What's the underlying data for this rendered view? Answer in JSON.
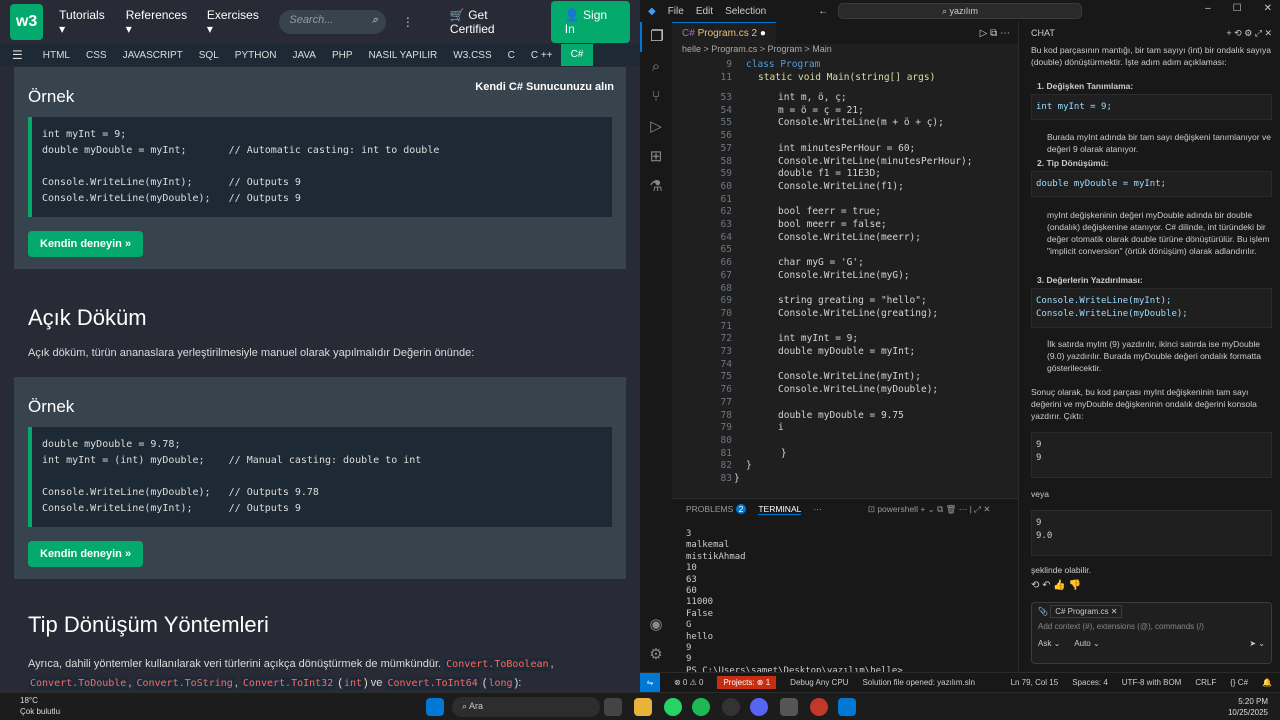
{
  "w3": {
    "logo": "w3 schools",
    "nav": [
      "Tutorials",
      "References",
      "Exercises"
    ],
    "search_placeholder": "Search...",
    "get_certified": "Get Certified",
    "sign_in": "Sign In",
    "topics": [
      "HTML",
      "CSS",
      "JAVASCRIPT",
      "SQL",
      "PYTHON",
      "JAVA",
      "PHP",
      "NASIL YAPILIR",
      "W3.CSS",
      "C",
      "C ++",
      "C#"
    ],
    "active_topic": "C#"
  },
  "page": {
    "example1_heading": "Örnek",
    "kendi_server": "Kendi C# Sunucunuzu alın",
    "try_button": "Kendin deneyin »",
    "explicit_heading": "Açık Döküm",
    "explicit_text": "Açık döküm, türün ananaslara yerleştirilmesiyle manuel olarak yapılmalıdır Değerin önünde:",
    "example2_heading": "Örnek",
    "methods_heading": "Tip Dönüşüm Yöntemleri",
    "methods_text": "Ayrıca, dahili yöntemler kullanılarak veri türlerini açıkça dönüştürmek de mümkündür.",
    "methods_chips": [
      "Convert.ToBoolean",
      "Convert.ToDouble",
      "Convert.ToString",
      "Convert.ToInt32",
      "int",
      "ve",
      "Convert.ToInt64",
      "long"
    ]
  },
  "code1": [
    "int myInt = 9;",
    "double myDouble = myInt;       // Automatic casting: int to double",
    "",
    "Console.WriteLine(myInt);      // Outputs 9",
    "Console.WriteLine(myDouble);   // Outputs 9"
  ],
  "code2": [
    "double myDouble = 9.78;",
    "int myInt = (int) myDouble;    // Manual casting: double to int",
    "",
    "Console.WriteLine(myDouble);   // Outputs 9.78",
    "Console.WriteLine(myInt);      // Outputs 9"
  ],
  "vscode": {
    "menu": [
      "File",
      "Edit",
      "Selection"
    ],
    "command_search": "yazılım",
    "tab": "Program.cs 2",
    "breadcrumb": "helle > Program.cs > Program > Main",
    "sticky": [
      {
        "num": "9",
        "text": "class Program"
      },
      {
        "num": "11",
        "text": "static void Main(string[] args)"
      }
    ],
    "lines": [
      {
        "num": "53",
        "text": "int m, ö, ç;"
      },
      {
        "num": "54",
        "text": "m = ö = ç = 21;"
      },
      {
        "num": "55",
        "text": "Console.WriteLine(m + ö + ç);"
      },
      {
        "num": "56",
        "text": ""
      },
      {
        "num": "57",
        "text": "int minutesPerHour = 60;"
      },
      {
        "num": "58",
        "text": "Console.WriteLine(minutesPerHour);"
      },
      {
        "num": "59",
        "text": "double f1 = 11E3D;"
      },
      {
        "num": "60",
        "text": "Console.WriteLine(f1);"
      },
      {
        "num": "61",
        "text": ""
      },
      {
        "num": "62",
        "text": "bool feerr = true;"
      },
      {
        "num": "63",
        "text": "bool meerr = false;"
      },
      {
        "num": "64",
        "text": "Console.WriteLine(meerr);"
      },
      {
        "num": "65",
        "text": ""
      },
      {
        "num": "66",
        "text": "char myG = 'G';"
      },
      {
        "num": "67",
        "text": "Console.WriteLine(myG);"
      },
      {
        "num": "68",
        "text": ""
      },
      {
        "num": "69",
        "text": "string greating = \"hello\";"
      },
      {
        "num": "70",
        "text": "Console.WriteLine(greating);"
      },
      {
        "num": "71",
        "text": ""
      },
      {
        "num": "72",
        "text": "int myInt = 9;"
      },
      {
        "num": "73",
        "text": "double myDouble = myInt;"
      },
      {
        "num": "74",
        "text": ""
      },
      {
        "num": "75",
        "text": "Console.WriteLine(myInt);"
      },
      {
        "num": "76",
        "text": "Console.WriteLine(myDouble);"
      },
      {
        "num": "77",
        "text": ""
      },
      {
        "num": "78",
        "text": "double myDouble = 9.75"
      },
      {
        "num": "79",
        "text": "i"
      },
      {
        "num": "80",
        "text": ""
      },
      {
        "num": "81",
        "text": "    }"
      },
      {
        "num": "82",
        "text": "}"
      },
      {
        "num": "83",
        "text": "}"
      }
    ],
    "panel_tabs": [
      "PROBLEMS",
      "TERMINAL"
    ],
    "problems_count": "2",
    "shell": "powershell",
    "terminal": [
      "3",
      "malkemal",
      "mistikAhmad",
      "10",
      "63",
      "60",
      "11000",
      "False",
      "G",
      "hello",
      "9",
      "9",
      "PS C:\\Users\\samet\\Desktop\\yazılım\\helle> "
    ],
    "status": [
      "Projects: ⊗ 1",
      "Debug Any CPU",
      "Solution file opened: yazılım.sln",
      "Ln 79, Col 15",
      "Spaces: 4",
      "UTF-8 with BOM",
      "CRLF",
      "{} C#"
    ]
  },
  "chat": {
    "title": "CHAT",
    "intro": "Bu kod parçasının mantığı, bir tam sayıyı (int) bir ondalık sayıya (double) dönüştürmektir. İşte adım adım açıklaması:",
    "step1": "1. Değişken Tanımlama:",
    "code_a": "int myInt = 9;",
    "text_a": "Burada myInt adında bir tam sayı değişkeni tanımlanıyor ve değeri 9 olarak atanıyor.",
    "step2": "2. Tip Dönüşümü:",
    "code_b": "double myDouble = myInt;",
    "text_b": "myInt değişkeninin değeri myDouble adında bir double (ondalık) değişkenine atanıyor. C# dilinde, int türündeki bir değer otomatik olarak double türüne dönüştürülür. Bu işlem \"implicit conversion\" (örtük dönüşüm) olarak adlandırılır.",
    "step3": "3. Değerlerin Yazdırılması:",
    "code_c": "Console.WriteLine(myInt);\nConsole.WriteLine(myDouble);",
    "text_c": "İlk satırda myInt (9) yazdırılır, ikinci satırda ise myDouble (9.0) yazdırılır. Burada myDouble değeri ondalık formatta gösterilecektir.",
    "summary": "Sonuç olarak, bu kod parçası myInt değişkeninin tam sayı değerini ve myDouble değişkeninin ondalık değerini konsola yazdırır. Çıktı:",
    "out1": "9\n9",
    "veya": "veya",
    "out2": "9\n9.0",
    "sekil": "şeklinde olabilir.",
    "attachment": "Program.cs",
    "input_placeholder": "Add context (#), extensions (@), commands (/)",
    "ask": "Ask",
    "auto": "Auto"
  },
  "taskbar": {
    "weather_temp": "18°C",
    "weather_desc": "Çok bulutlu",
    "search": "Ara",
    "time": "5:20 PM",
    "date": "10/25/2025"
  }
}
